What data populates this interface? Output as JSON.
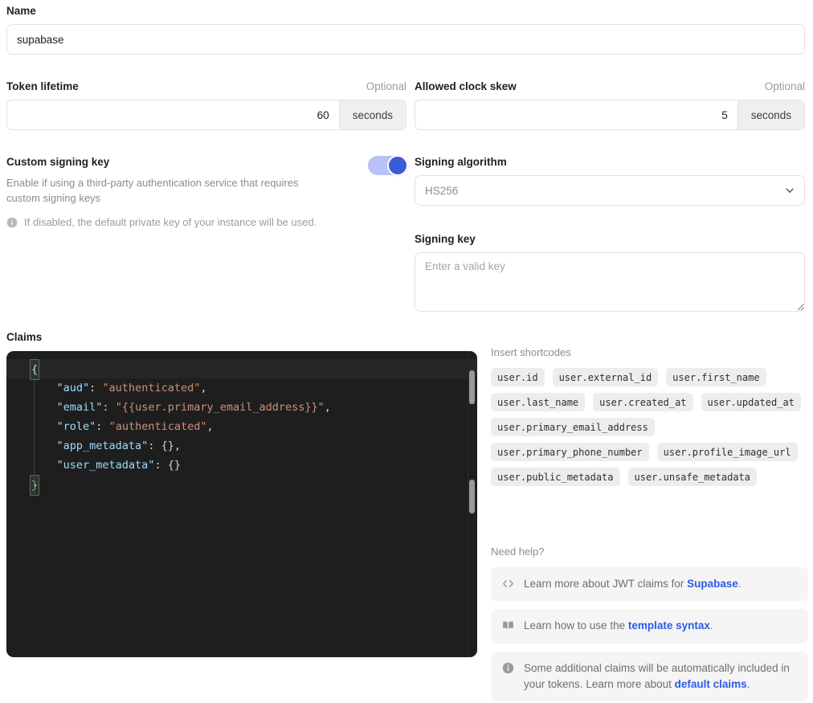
{
  "form": {
    "name": {
      "label": "Name",
      "value": "supabase"
    },
    "token_lifetime": {
      "label": "Token lifetime",
      "optional_label": "Optional",
      "value": "60",
      "unit": "seconds"
    },
    "clock_skew": {
      "label": "Allowed clock skew",
      "optional_label": "Optional",
      "value": "5",
      "unit": "seconds"
    },
    "custom_signing_key": {
      "label": "Custom signing key",
      "description": "Enable if using a third-party authentication service that requires custom signing keys",
      "note": "If disabled, the default private key of your instance will be used.",
      "note_icon": "info-icon",
      "enabled": true,
      "toggle_track_color": "#b9c2f6",
      "toggle_knob_color": "#3b5bdb"
    },
    "signing_algorithm": {
      "label": "Signing algorithm",
      "selected": "HS256",
      "chevron_icon": "chevron-down-icon"
    },
    "signing_key": {
      "label": "Signing key",
      "placeholder": "Enter a valid key",
      "value": ""
    }
  },
  "claims": {
    "label": "Claims",
    "lines": [
      {
        "indent": 0,
        "active": true,
        "segments": [
          {
            "type": "brace",
            "text": "{"
          }
        ]
      },
      {
        "indent": 1,
        "active": false,
        "segments": [
          {
            "type": "key",
            "text": "\"aud\""
          },
          {
            "type": "punct",
            "text": ": "
          },
          {
            "type": "str",
            "text": "\"authenticated\""
          },
          {
            "type": "punct",
            "text": ","
          }
        ]
      },
      {
        "indent": 1,
        "active": false,
        "segments": [
          {
            "type": "key",
            "text": "\"email\""
          },
          {
            "type": "punct",
            "text": ": "
          },
          {
            "type": "str",
            "text": "\"{{user.primary_email_address}}\""
          },
          {
            "type": "punct",
            "text": ","
          }
        ]
      },
      {
        "indent": 1,
        "active": false,
        "segments": [
          {
            "type": "key",
            "text": "\"role\""
          },
          {
            "type": "punct",
            "text": ": "
          },
          {
            "type": "str",
            "text": "\"authenticated\""
          },
          {
            "type": "punct",
            "text": ","
          }
        ]
      },
      {
        "indent": 1,
        "active": false,
        "segments": [
          {
            "type": "key",
            "text": "\"app_metadata\""
          },
          {
            "type": "punct",
            "text": ": {},"
          }
        ]
      },
      {
        "indent": 1,
        "active": false,
        "segments": [
          {
            "type": "key",
            "text": "\"user_metadata\""
          },
          {
            "type": "punct",
            "text": ": {}"
          }
        ]
      },
      {
        "indent": 0,
        "active": false,
        "segments": [
          {
            "type": "brace",
            "text": "}"
          }
        ]
      }
    ],
    "raw_text": "{\n    \"aud\": \"authenticated\",\n    \"email\": \"{{user.primary_email_address}}\",\n    \"role\": \"authenticated\",\n    \"app_metadata\": {},\n    \"user_metadata\": {}\n}",
    "editor_background": "#1e1e1e",
    "key_color": "#9cdcfe",
    "string_color": "#ce9178",
    "punct_color": "#d4d4d4"
  },
  "shortcodes": {
    "heading": "Insert shortcodes",
    "items": [
      "user.id",
      "user.external_id",
      "user.first_name",
      "user.last_name",
      "user.created_at",
      "user.updated_at",
      "user.primary_email_address",
      "user.primary_phone_number",
      "user.profile_image_url",
      "user.public_metadata",
      "user.unsafe_metadata"
    ]
  },
  "help": {
    "heading": "Need help?",
    "link_color": "#2d5ce8",
    "cards": [
      {
        "icon": "code-icon",
        "prefix": "Learn more about JWT claims for ",
        "link": "Supabase",
        "suffix": "."
      },
      {
        "icon": "book-icon",
        "prefix": "Learn how to use the ",
        "link": "template syntax",
        "suffix": "."
      },
      {
        "icon": "info-icon",
        "prefix": "Some additional claims will be automatically included in your tokens. Learn more about ",
        "link": "default claims",
        "suffix": "."
      }
    ]
  }
}
